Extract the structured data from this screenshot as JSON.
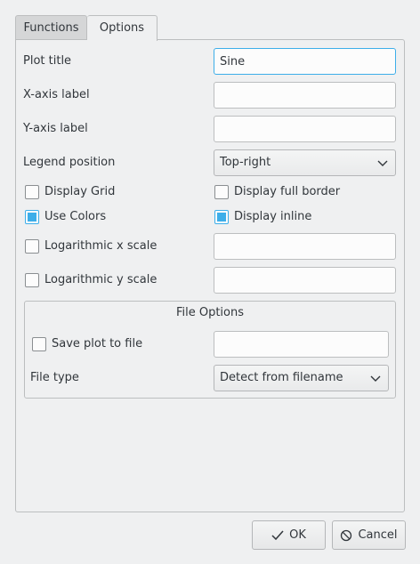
{
  "tabs": {
    "functions": "Functions",
    "options": "Options"
  },
  "options": {
    "plot_title": {
      "label": "Plot title",
      "value": "Sine"
    },
    "x_axis_label": {
      "label": "X-axis label",
      "value": ""
    },
    "y_axis_label": {
      "label": "Y-axis label",
      "value": ""
    },
    "legend_position": {
      "label": "Legend position",
      "selected": "Top-right"
    },
    "display_grid": {
      "label": "Display Grid",
      "checked": false
    },
    "display_full_border": {
      "label": "Display full border",
      "checked": false
    },
    "use_colors": {
      "label": "Use Colors",
      "checked": true
    },
    "display_inline": {
      "label": "Display inline",
      "checked": true
    },
    "log_x_scale": {
      "label": "Logarithmic x scale",
      "checked": false,
      "value": ""
    },
    "log_y_scale": {
      "label": "Logarithmic y scale",
      "checked": false,
      "value": ""
    }
  },
  "file_options": {
    "title": "File Options",
    "save_plot": {
      "label": "Save plot to file",
      "checked": false,
      "value": ""
    },
    "file_type": {
      "label": "File type",
      "selected": "Detect from filename"
    }
  },
  "buttons": {
    "ok": "OK",
    "cancel": "Cancel"
  },
  "colors": {
    "accent": "#3daee9",
    "window_bg": "#eff0f1",
    "text": "#31363b"
  },
  "icons": {
    "ok": "check-icon",
    "cancel": "cancel-icon",
    "dropdown": "chevron-down-icon"
  }
}
